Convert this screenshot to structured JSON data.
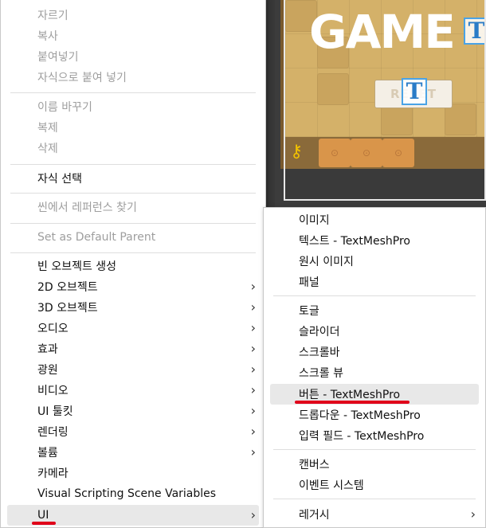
{
  "game_view": {
    "title": "GAME",
    "reset_label": "RESET",
    "tmp_glyph": "T",
    "key_glyph": "⚷",
    "block_glyph": "⊙"
  },
  "main_menu": {
    "cut": "자르기",
    "copy": "복사",
    "paste": "붙여넣기",
    "paste_as_child": "자식으로 붙여 넣기",
    "rename": "이름 바꾸기",
    "duplicate": "복제",
    "delete": "삭제",
    "select_children": "자식 선택",
    "find_references": "씬에서 레퍼런스 찾기",
    "set_default_parent": "Set as Default Parent",
    "create_empty": "빈 오브젝트 생성",
    "object_2d": "2D 오브젝트",
    "object_3d": "3D 오브젝트",
    "audio": "오디오",
    "effects": "효과",
    "light": "광원",
    "video": "비디오",
    "ui_toolkit": "UI 툴킷",
    "rendering": "렌더링",
    "volume": "볼륨",
    "camera": "카메라",
    "visual_scripting": "Visual Scripting Scene Variables",
    "ui": "UI",
    "chevron": "›"
  },
  "sub_menu": {
    "image": "이미지",
    "text_tmp": "텍스트 - TextMeshPro",
    "raw_image": "원시 이미지",
    "panel": "패널",
    "toggle": "토글",
    "slider": "슬라이더",
    "scrollbar": "스크롤바",
    "scroll_view": "스크롤 뷰",
    "button_tmp": "버튼 - TextMeshPro",
    "dropdown_tmp": "드롭다운 - TextMeshPro",
    "input_field_tmp": "입력 필드 - TextMeshPro",
    "canvas": "캔버스",
    "event_system": "이벤트 시스템",
    "legacy": "레거시",
    "chevron": "›"
  },
  "colors": {
    "annotation_underline": "#e0001a",
    "menu_bg": "#ffffff",
    "disabled_text": "#9e9e9e",
    "hover_bg": "#e8e8e8"
  }
}
